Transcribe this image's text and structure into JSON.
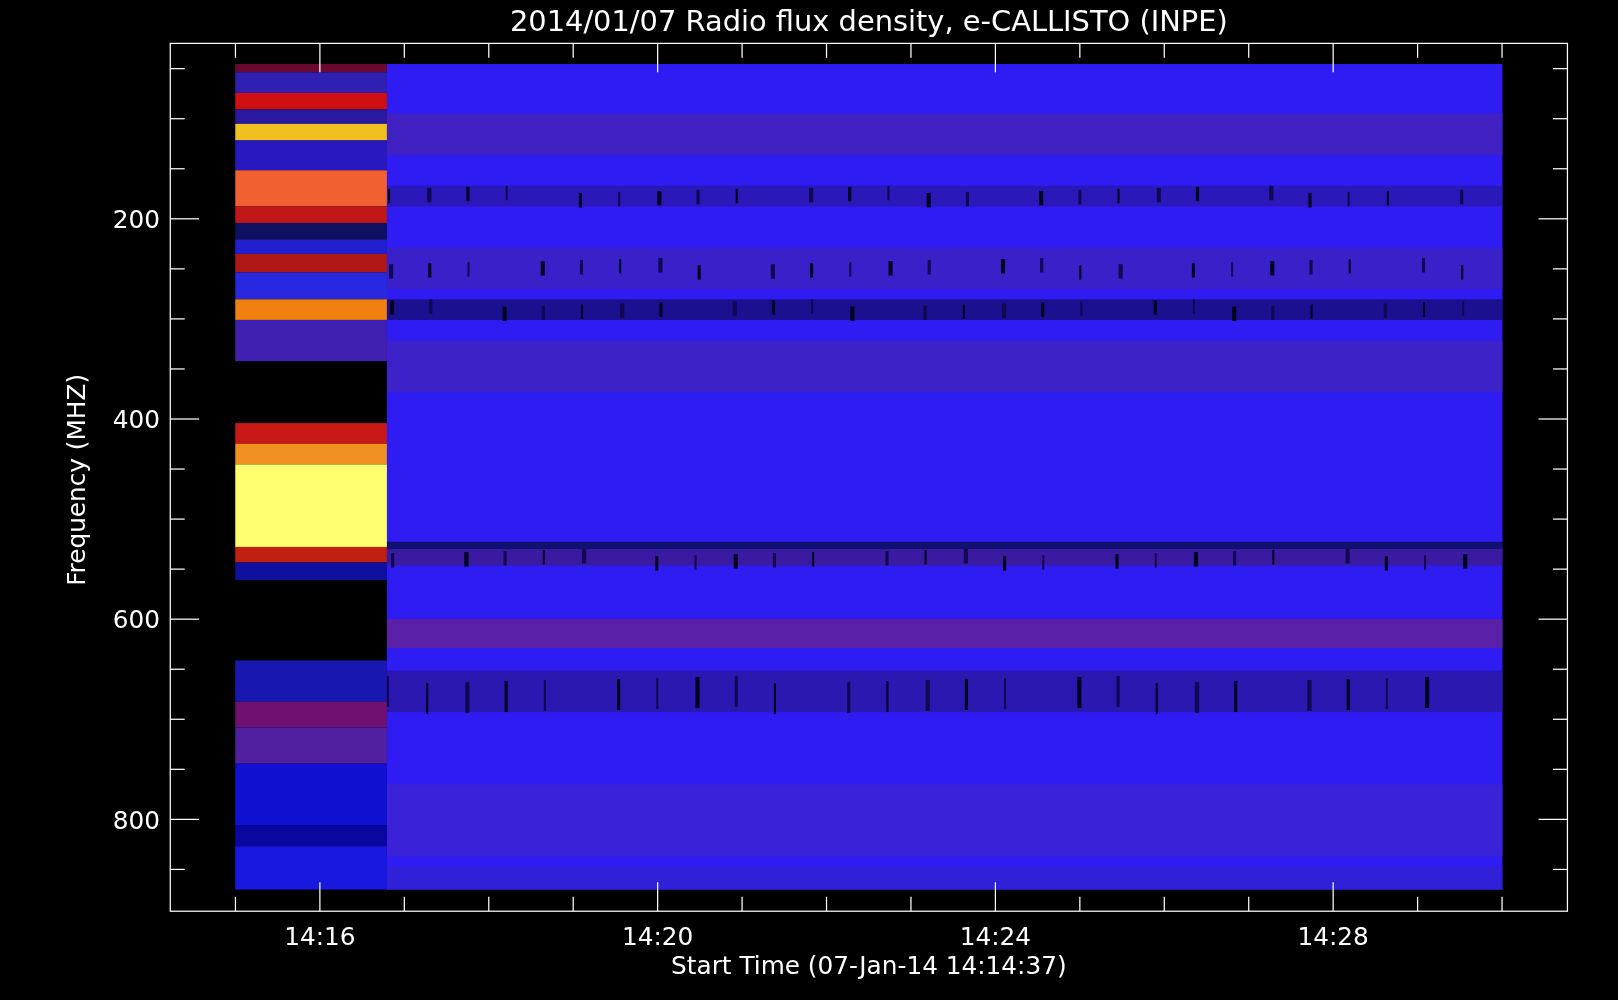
{
  "title": "2014/01/07  Radio flux density, e-CALLISTO (INPE)",
  "ylabel": "Frequency (MHZ)",
  "xlabel": "Start Time (07-Jan-14 14:14:37)",
  "ytick_labels": [
    "200",
    "400",
    "600",
    "800"
  ],
  "xtick_labels": [
    "14:16",
    "14:20",
    "14:24",
    "14:28"
  ]
}
